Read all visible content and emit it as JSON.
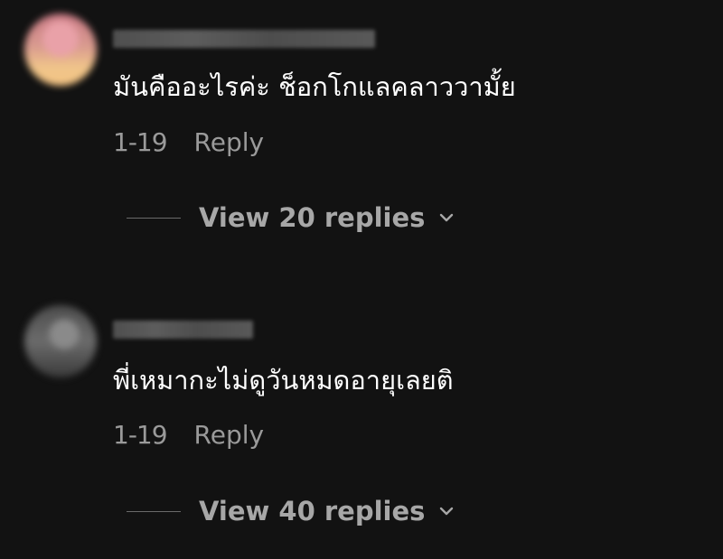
{
  "comments": [
    {
      "text": "มันคืออะไรค่ะ ช็อกโกแลคลาววามั้ย",
      "date": "1-19",
      "reply_label": "Reply",
      "view_replies_label": "View 20 replies",
      "avatar_color": "#d89a8f"
    },
    {
      "text": "พี่เหมากะไม่ดูวันหมดอายุเลยติ",
      "date": "1-19",
      "reply_label": "Reply",
      "view_replies_label": "View 40 replies",
      "avatar_color": "#6b6b6b"
    }
  ],
  "icons": {
    "chevron": "chevron-down-icon"
  },
  "colors": {
    "background": "#121212",
    "text": "#ffffff",
    "muted": "#9a9a9a"
  }
}
